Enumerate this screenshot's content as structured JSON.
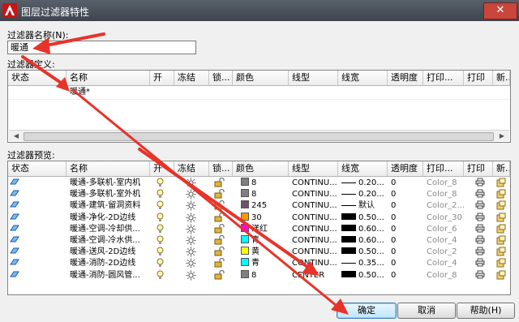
{
  "window": {
    "title": "图层过滤器特性",
    "close_symbol": "✕",
    "accent": "#e8332a"
  },
  "filter_name": {
    "label": "过滤器名称(N):",
    "value": "暖通"
  },
  "definition": {
    "label": "过滤器定义:",
    "columns": [
      "状态",
      "名称",
      "开",
      "冻结",
      "锁...",
      "颜色",
      "线型",
      "线宽",
      "透明度",
      "打印...",
      "打印",
      "新..."
    ],
    "rows": [
      {
        "name": "暖通*"
      }
    ]
  },
  "preview": {
    "label": "过滤器预览:",
    "columns": [
      "状态",
      "名称",
      "开",
      "冻结",
      "锁...",
      "颜色",
      "线型",
      "线宽",
      "透明度",
      "打印...",
      "打印",
      "新..."
    ],
    "rows": [
      {
        "name": "暖通-多联机-室内机",
        "color_hex": "#808080",
        "color": "8",
        "linetype": "CONTINU...",
        "lw_style": "line",
        "lineweight": "0.20...",
        "transparency": "0",
        "plot_style": "Color_8"
      },
      {
        "name": "暖通-多联机-室外机",
        "color_hex": "#808080",
        "color": "8",
        "linetype": "CONTINU...",
        "lw_style": "line",
        "lineweight": "0.20...",
        "transparency": "0",
        "plot_style": "Color_8"
      },
      {
        "name": "暖通-建筑-留洞资料",
        "color_hex": "#6e4f6e",
        "color": "245",
        "linetype": "CONTINU...",
        "lw_style": "line",
        "lineweight": "默认",
        "transparency": "0",
        "plot_style": "Color_2..."
      },
      {
        "name": "暖通-净化-2D边线",
        "color_hex": "#ff9a00",
        "color": "30",
        "linetype": "CONTINU...",
        "lw_style": "block",
        "lineweight": "0.50...",
        "transparency": "0",
        "plot_style": "Color_30"
      },
      {
        "name": "暖通-空调-冷却供...",
        "color_hex": "#ff00ff",
        "color": "洋红",
        "linetype": "CONTINU...",
        "lw_style": "block",
        "lineweight": "0.60...",
        "transparency": "0",
        "plot_style": "Color_6"
      },
      {
        "name": "暖通-空调-冷水供...",
        "color_hex": "#00ffff",
        "color": "青",
        "linetype": "CONTINU...",
        "lw_style": "block",
        "lineweight": "0.60...",
        "transparency": "0",
        "plot_style": "Color_4"
      },
      {
        "name": "暖通-送风-2D边线",
        "color_hex": "#ffff00",
        "color": "黄",
        "linetype": "CONTINU...",
        "lw_style": "block",
        "lineweight": "0.50...",
        "transparency": "0",
        "plot_style": "Color_2"
      },
      {
        "name": "暖通-消防-2D边线",
        "color_hex": "#00ffff",
        "color": "青",
        "linetype": "CONTINU...",
        "lw_style": "line",
        "lineweight": "0.35...",
        "transparency": "0",
        "plot_style": "Color_4"
      },
      {
        "name": "暖通-消防-圆风管...",
        "color_hex": "#808080",
        "color": "8",
        "linetype": "CENTER",
        "lw_style": "block",
        "lineweight": "0.50...",
        "transparency": "0",
        "plot_style": "Color_8"
      }
    ]
  },
  "buttons": {
    "ok": "确定",
    "cancel": "取消",
    "help": "帮助(H)"
  }
}
